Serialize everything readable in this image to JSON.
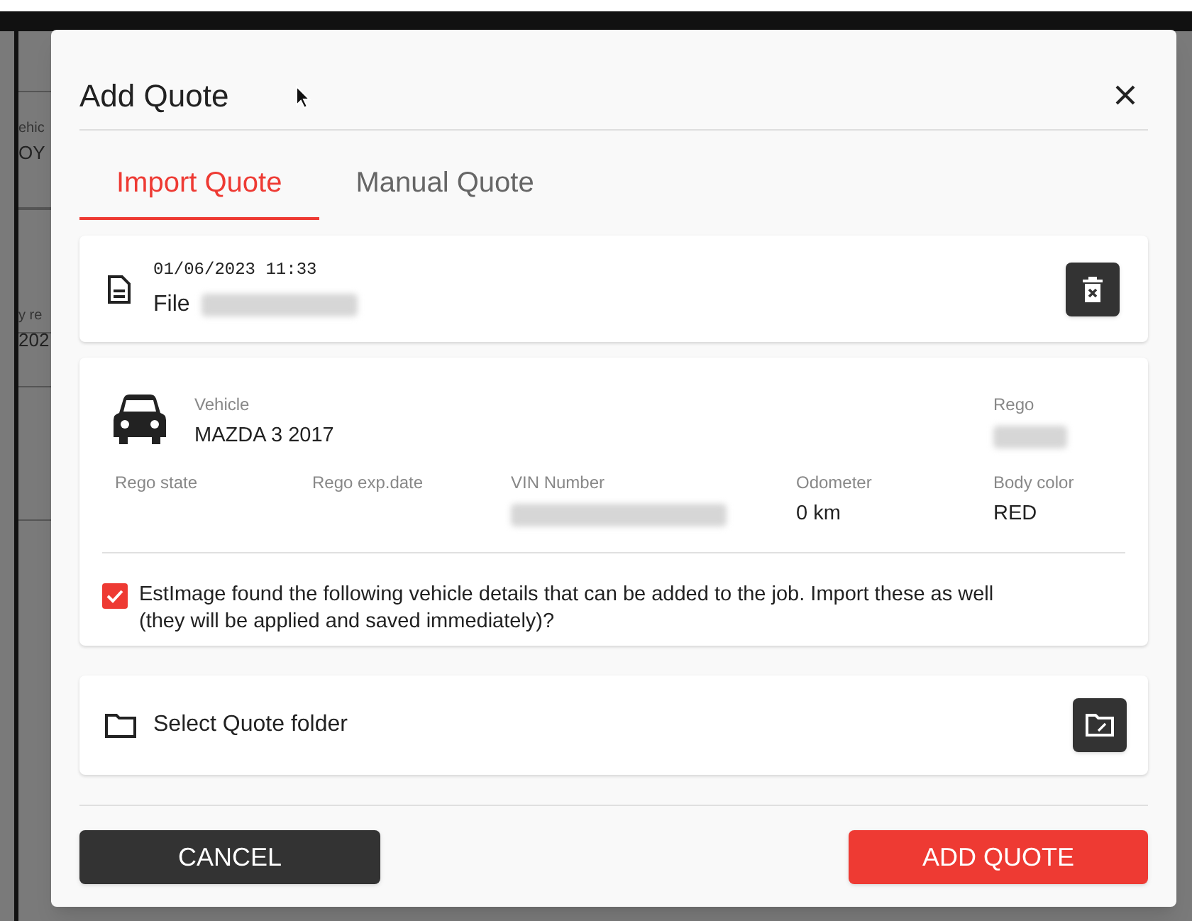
{
  "background": {
    "fragments": [
      {
        "text": "ehic",
        "kind": "label"
      },
      {
        "text": "OY",
        "kind": "value"
      },
      {
        "text": "y re",
        "kind": "label"
      },
      {
        "text": "202",
        "kind": "value"
      }
    ]
  },
  "dialog": {
    "title": "Add Quote",
    "tabs": [
      {
        "label": "Import Quote",
        "selected": true
      },
      {
        "label": "Manual Quote",
        "selected": false
      }
    ],
    "file": {
      "timestamp": "01/06/2023 11:33",
      "label": "File",
      "blurred": true
    },
    "vehicle": {
      "primary": [
        {
          "label": "Vehicle",
          "value": "MAZDA 3 2017",
          "blurred": false
        },
        {
          "label": "Rego",
          "blurred": true
        }
      ],
      "details": [
        {
          "label": "Rego state",
          "blurred": false
        },
        {
          "label": "Rego exp.date",
          "blurred": false
        },
        {
          "label": "VIN Number",
          "blurred": true
        },
        {
          "label": "Odometer",
          "value": "0 km",
          "blurred": false
        },
        {
          "label": "Body color",
          "value": "RED",
          "blurred": false
        }
      ]
    },
    "import_prompt": {
      "checked": true,
      "text": "EstImage found the following vehicle details that can be added to the job. Import these as well (they will be applied and saved immediately)?"
    },
    "folder": {
      "label": "Select Quote folder"
    },
    "buttons": [
      {
        "label": "CANCEL",
        "kind": "secondary"
      },
      {
        "label": "ADD QUOTE",
        "kind": "primary"
      }
    ]
  }
}
